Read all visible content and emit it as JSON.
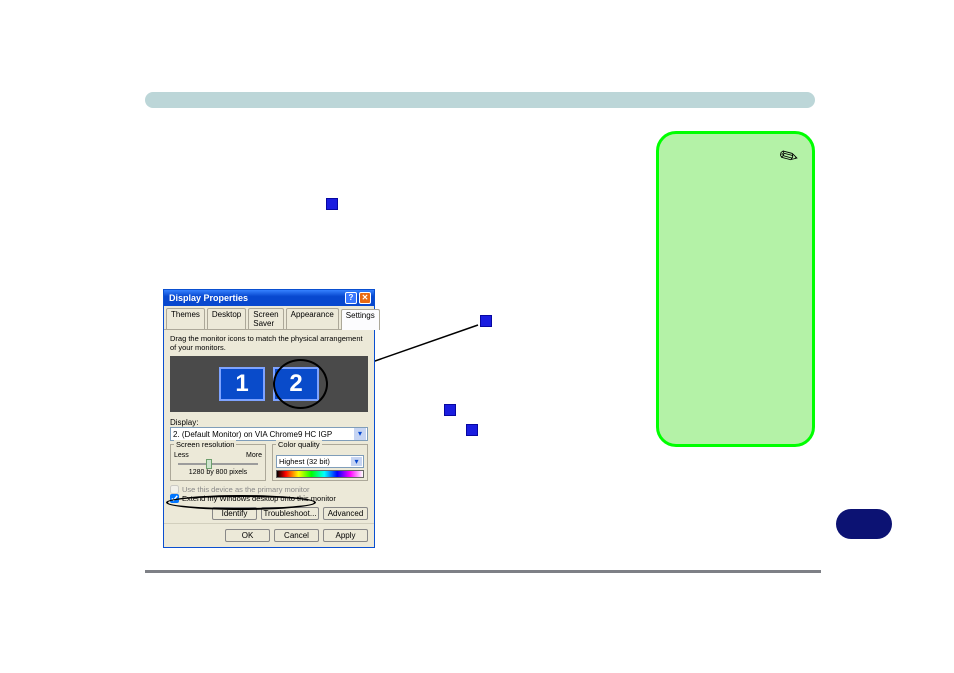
{
  "dialog": {
    "title": "Display Properties",
    "close_icon": "✕",
    "help_icon": "?",
    "tabs": [
      "Themes",
      "Desktop",
      "Screen Saver",
      "Appearance",
      "Settings"
    ],
    "hint": "Drag the monitor icons to match the physical arrangement of your monitors.",
    "monitors": [
      "1",
      "2"
    ],
    "display_label": "Display:",
    "display_value": "2. (Default Monitor) on VIA Chrome9 HC IGP",
    "res_group": "Screen resolution",
    "res_less": "Less",
    "res_more": "More",
    "res_value": "1280 by 800 pixels",
    "cq_group": "Color quality",
    "cq_value": "Highest (32 bit)",
    "chk_primary": "Use this device as the primary monitor",
    "chk_extend": "Extend my Windows desktop onto this monitor",
    "btn_identify": "Identify",
    "btn_trouble": "Troubleshoot...",
    "btn_adv": "Advanced",
    "btn_ok": "OK",
    "btn_cancel": "Cancel",
    "btn_apply": "Apply"
  }
}
